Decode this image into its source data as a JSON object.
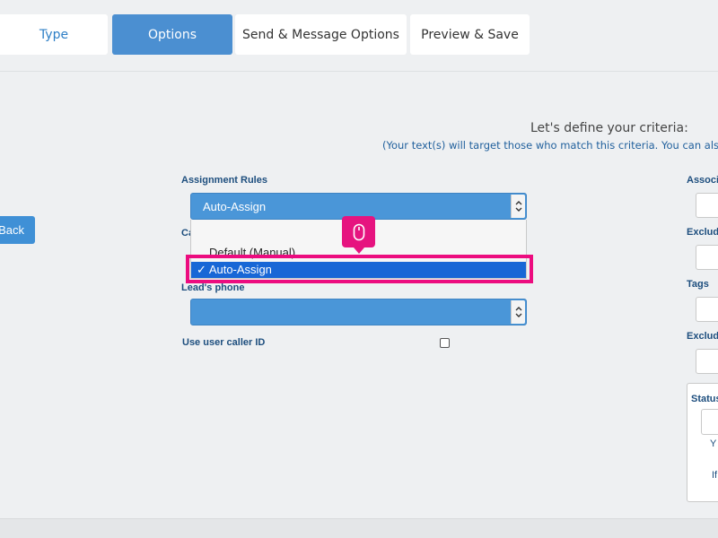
{
  "tabs": [
    {
      "label": "Type"
    },
    {
      "label": "Options"
    },
    {
      "label": "Send & Message Options"
    },
    {
      "label": "Preview & Save"
    }
  ],
  "back_label": "Back",
  "heading": "Let's define your criteria:",
  "subheading": "(Your text(s) will target those who match this criteria. You can also e",
  "left_form": {
    "assignment_rules_label": "Assignment Rules",
    "assignment_select_value": "Auto-Assign",
    "dropdown_options": [
      "Default (Manual)",
      "Auto-Assign"
    ],
    "selected_option_checkmark": "✓",
    "campaign_label_partial": "Ca",
    "leads_phone_label": "Lead's phone",
    "leads_phone_value": "",
    "use_caller_id_label": "Use user caller ID"
  },
  "right_form": {
    "associ_label": "Associ",
    "exclude1_label": "Exclud",
    "tags_label": "Tags",
    "exclude2_label": "Exclud",
    "status_label": "Status",
    "panel_text_y": "Y",
    "panel_text_if": "If"
  },
  "colors": {
    "accent": "#4b8fd1",
    "select_blue": "#4a96d8",
    "selected_option": "#1867d6",
    "highlight": "#ec0c7f",
    "label_navy": "#1d4e7e"
  },
  "icons": {
    "mouse": "mouse-click-icon",
    "chevron": "chevron-updown-icon"
  }
}
